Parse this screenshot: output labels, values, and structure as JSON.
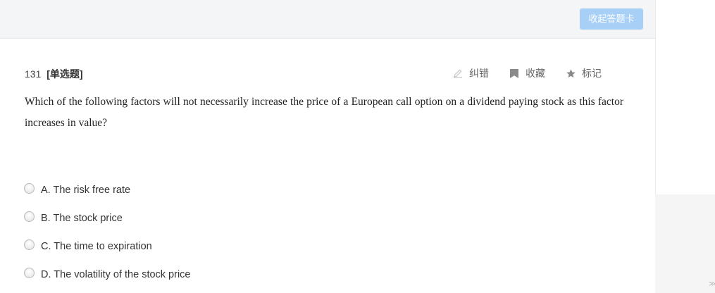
{
  "toolbar": {
    "collapse_answer_card_label": "收起答题卡",
    "accent_color": "#a8d0f7"
  },
  "question": {
    "number": "131",
    "type": "[单选题]",
    "stem": "Which of the following factors will not necessarily increase the price of a European call option on a dividend paying stock as this factor increases in value?",
    "actions": [
      {
        "label": "纠错",
        "icon": "pencil-icon"
      },
      {
        "label": "收藏",
        "icon": "bookmark-icon"
      },
      {
        "label": "标记",
        "icon": "star-icon"
      }
    ],
    "options": [
      {
        "label": "A. The risk free rate",
        "selected": false
      },
      {
        "label": "B. The stock price",
        "selected": false
      },
      {
        "label": "C. The time to expiration",
        "selected": false
      },
      {
        "label": "D. The volatility of the stock price",
        "selected": false
      }
    ]
  },
  "gutter": {
    "mark": "≫"
  }
}
